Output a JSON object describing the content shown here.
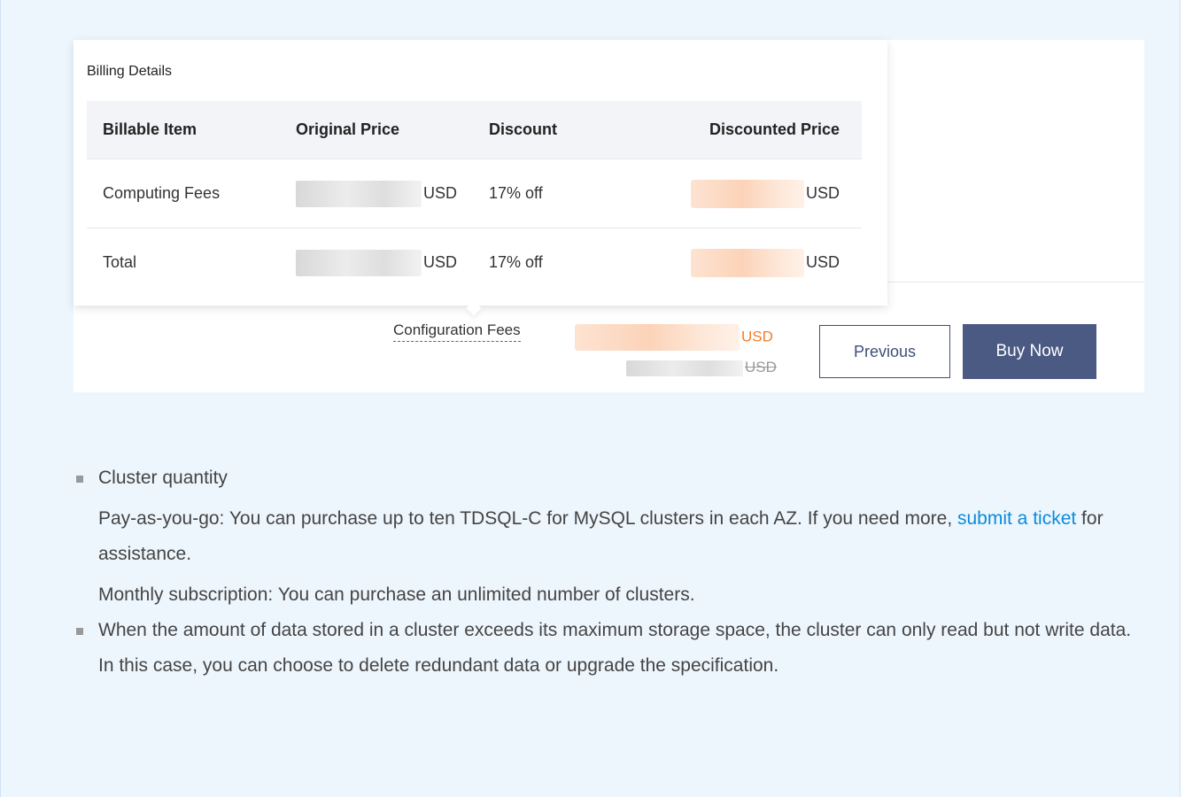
{
  "billing": {
    "title": "Billing Details",
    "headers": [
      "Billable Item",
      "Original Price",
      "Discount",
      "Discounted Price"
    ],
    "rows": [
      {
        "item": "Computing Fees",
        "original": "USD",
        "discount": "17% off",
        "discounted": "USD"
      },
      {
        "item": "Total",
        "original": "USD",
        "discount": "17% off",
        "discounted": "USD"
      }
    ]
  },
  "footer": {
    "config_label": "Configuration Fees",
    "config_price_suffix": "USD",
    "config_old_suffix": "USD",
    "previous_label": "Previous",
    "buy_label": "Buy Now"
  },
  "notes": {
    "cluster_title": "Cluster quantity",
    "payg_text_1": "Pay-as-you-go: You can purchase up to ten TDSQL-C for MySQL clusters in each AZ. If you need more, ",
    "payg_link": "submit a ticket",
    "payg_text_2": " for assistance.",
    "monthly_text": "Monthly subscription: You can purchase an unlimited number of clusters.",
    "storage_text": "When the amount of data stored in a cluster exceeds its maximum storage space, the cluster can only read but not write data. In this case, you can choose to delete redundant data or upgrade the specification."
  },
  "colors": {
    "accent_orange": "#f47c2a",
    "primary_button": "#4a5a82",
    "link": "#0a8bdc",
    "panel_bg": "#eef6fd"
  }
}
